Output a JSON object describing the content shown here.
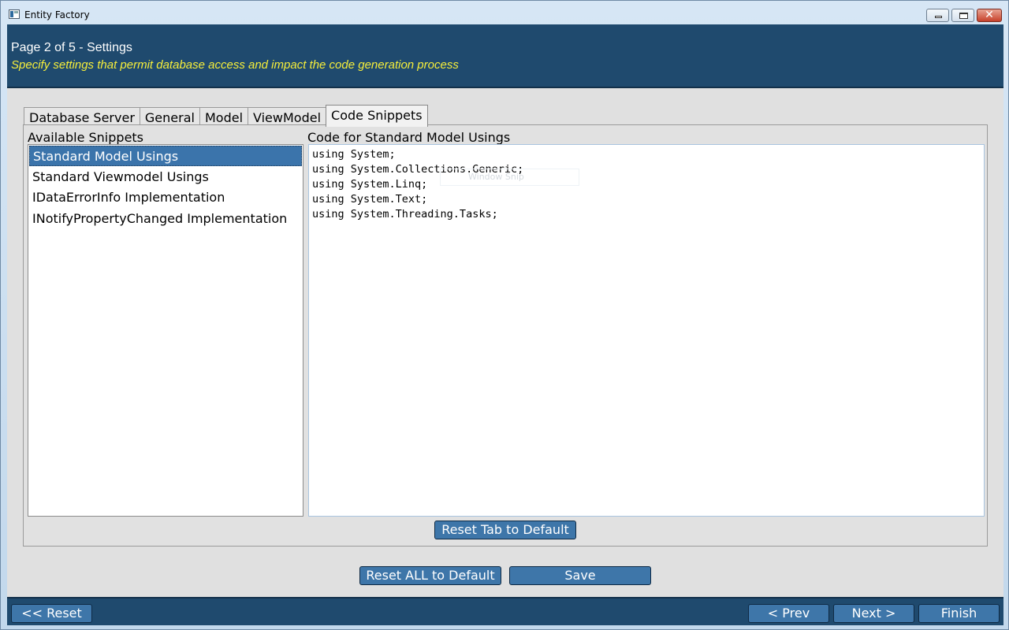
{
  "window": {
    "title": "Entity Factory"
  },
  "header": {
    "title": "Page 2 of 5 - Settings",
    "subtitle": "Specify settings that permit database access and impact the code generation process"
  },
  "tabs": [
    {
      "label": "Database Server"
    },
    {
      "label": "General"
    },
    {
      "label": "Model"
    },
    {
      "label": "ViewModel"
    },
    {
      "label": "Code Snippets",
      "active": true
    }
  ],
  "snippets": {
    "label": "Available Snippets",
    "items": [
      "Standard Model Usings",
      "Standard Viewmodel Usings",
      "IDataErrorInfo Implementation",
      "INotifyPropertyChanged Implementation"
    ],
    "selected_index": 0
  },
  "code": {
    "label": "Code for Standard Model Usings",
    "lines": [
      "using System;",
      "using System.Collections.Generic;",
      "using System.Linq;",
      "using System.Text;",
      "using System.Threading.Tasks;"
    ]
  },
  "ghost_tooltip": "Window Snip",
  "buttons": {
    "reset_tab": "Reset Tab to Default",
    "reset_all": "Reset ALL to Default",
    "save": "Save",
    "reset": "<< Reset",
    "prev": "< Prev",
    "next": "Next >",
    "finish": "Finish"
  },
  "colors": {
    "header_bg": "#1f4a6e",
    "subtitle": "#f6ee3a",
    "button_bg": "#3e76a9",
    "selection": "#3b74ab"
  }
}
